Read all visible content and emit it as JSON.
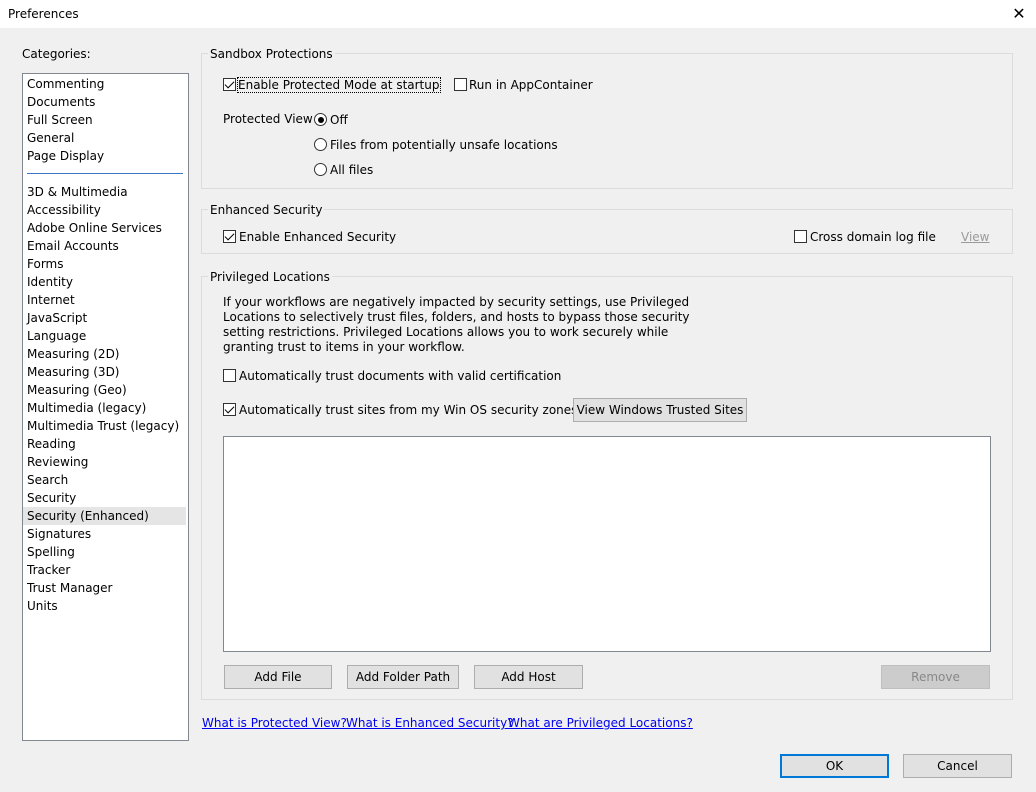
{
  "window": {
    "title": "Preferences",
    "close_glyph": "✕"
  },
  "categories": {
    "label": "Categories:",
    "group1": [
      "Commenting",
      "Documents",
      "Full Screen",
      "General",
      "Page Display"
    ],
    "group2": [
      "3D & Multimedia",
      "Accessibility",
      "Adobe Online Services",
      "Email Accounts",
      "Forms",
      "Identity",
      "Internet",
      "JavaScript",
      "Language",
      "Measuring (2D)",
      "Measuring (3D)",
      "Measuring (Geo)",
      "Multimedia (legacy)",
      "Multimedia Trust (legacy)",
      "Reading",
      "Reviewing",
      "Search",
      "Security",
      "Security (Enhanced)",
      "Signatures",
      "Spelling",
      "Tracker",
      "Trust Manager",
      "Units"
    ],
    "selected": "Security (Enhanced)"
  },
  "sandbox": {
    "title": "Sandbox Protections",
    "protected_mode_label": "Enable Protected Mode at startup",
    "protected_mode_checked": true,
    "app_container_label": "Run in AppContainer",
    "app_container_checked": false,
    "protected_view_label": "Protected View",
    "pv_options": [
      "Off",
      "Files from potentially unsafe locations",
      "All files"
    ],
    "pv_selected": "Off"
  },
  "enhanced": {
    "title": "Enhanced Security",
    "enable_label": "Enable Enhanced Security",
    "enable_checked": true,
    "cross_domain_label": "Cross domain log file",
    "cross_domain_checked": false,
    "view_label": "View"
  },
  "privileged": {
    "title": "Privileged Locations",
    "description": "If your workflows are negatively impacted by security settings, use Privileged Locations to selectively trust files, folders, and hosts to bypass those security setting restrictions. Privileged Locations allows you to work securely while granting trust to items in your workflow.",
    "trust_cert_label": "Automatically trust documents with valid certification",
    "trust_cert_checked": false,
    "trust_sites_label": "Automatically trust sites from my Win OS security zones",
    "trust_sites_checked": true,
    "view_trusted_label": "View Windows Trusted Sites",
    "locations": [],
    "add_file_label": "Add File",
    "add_folder_label": "Add Folder Path",
    "add_host_label": "Add Host",
    "remove_label": "Remove"
  },
  "links": {
    "protected_view": "What is Protected View?",
    "enhanced_security": "What is Enhanced Security?",
    "privileged_locations": "What are Privileged Locations?"
  },
  "footer": {
    "ok_label": "OK",
    "cancel_label": "Cancel"
  }
}
